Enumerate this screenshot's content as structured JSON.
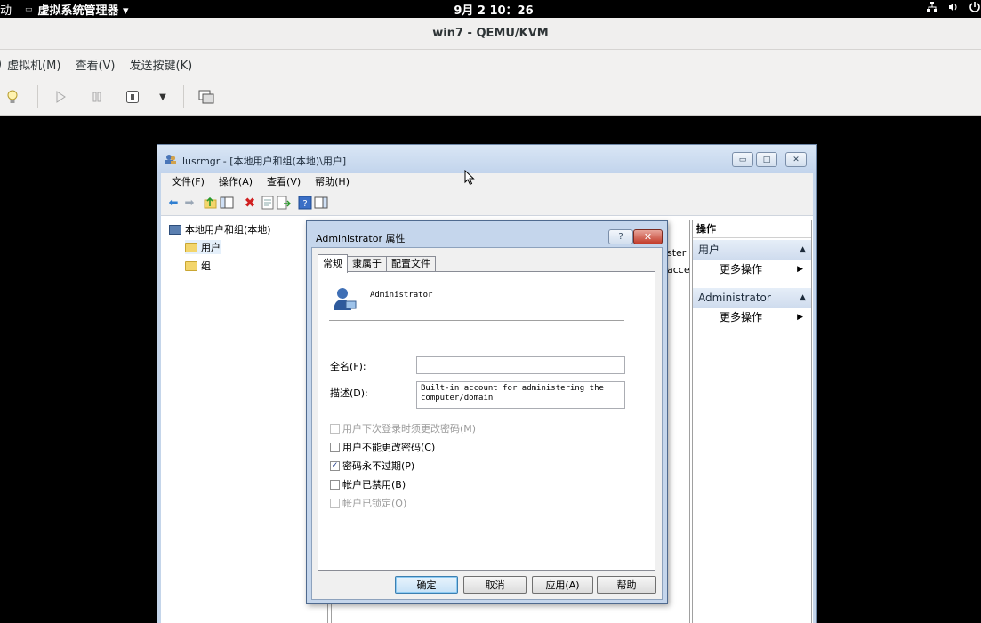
{
  "topbar": {
    "activities": "动",
    "app_name": "虚拟系统管理器 ▾",
    "app_icon": "▭",
    "clock": "9月 2 10：26",
    "tray_icons": [
      "network-icon",
      "volume-icon",
      "power-icon"
    ]
  },
  "vm_window": {
    "title": "win7 - QEMU/KVM",
    "menu": [
      ")",
      "虚拟机(M)",
      "查看(V)",
      "发送按键(K)"
    ]
  },
  "lusrmgr": {
    "title": "lusrmgr - [本地用户和组(本地)\\用户]",
    "menu": [
      "文件(F)",
      "操作(A)",
      "查看(V)",
      "帮助(H)"
    ],
    "tree": {
      "root": "本地用户和组(本地)",
      "children": [
        "用户",
        "组"
      ]
    },
    "center_fragments": [
      "ster",
      "acce"
    ],
    "actions": {
      "header": "操作",
      "sections": [
        {
          "title": "用户",
          "item": "更多操作"
        },
        {
          "title": "Administrator",
          "item": "更多操作"
        }
      ]
    }
  },
  "dialog": {
    "title": "Administrator 属性",
    "help_button": "?",
    "close_button": "✕",
    "tabs": [
      "常规",
      "隶属于",
      "配置文件"
    ],
    "username": "Administrator",
    "fullname_label": "全名(F):",
    "fullname_value": "",
    "description_label": "描述(D):",
    "description_value": "Built-in account for administering the computer/domain",
    "checkboxes": [
      {
        "label": "用户下次登录时须更改密码(M)",
        "checked": false,
        "enabled": false
      },
      {
        "label": "用户不能更改密码(C)",
        "checked": false,
        "enabled": true
      },
      {
        "label": "密码永不过期(P)",
        "checked": true,
        "enabled": true
      },
      {
        "label": "帐户已禁用(B)",
        "checked": false,
        "enabled": true
      },
      {
        "label": "帐户已锁定(O)",
        "checked": false,
        "enabled": false
      }
    ],
    "buttons": {
      "ok": "确定",
      "cancel": "取消",
      "apply": "应用(A)",
      "help": "帮助"
    }
  }
}
